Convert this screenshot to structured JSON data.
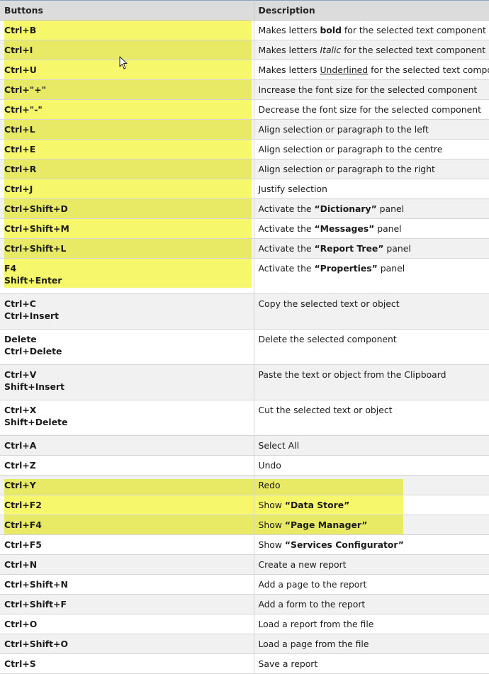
{
  "header": {
    "col_keys": "Buttons",
    "col_desc": "Description"
  },
  "colors": {
    "highlight": "#f6f76b",
    "header_bg": "#dcdcdc"
  },
  "rows": [
    {
      "keys": [
        "Ctrl+B"
      ],
      "desc": {
        "pre": "Makes letters ",
        "emph": "bold",
        "post": " for the selected text component"
      }
    },
    {
      "keys": [
        "Ctrl+I"
      ],
      "desc": {
        "pre": "Makes letters ",
        "emph": "Italic",
        "post": " for the selected text component"
      }
    },
    {
      "keys": [
        "Ctrl+U"
      ],
      "desc": {
        "pre": "Makes letters ",
        "emph": "Underlined",
        "post": " for the selected text compone"
      }
    },
    {
      "keys": [
        "Ctrl+\"+\""
      ],
      "desc": {
        "pre": "Increase the font size for the selected component",
        "emph": "",
        "post": ""
      }
    },
    {
      "keys": [
        "Ctrl+\"-\""
      ],
      "desc": {
        "pre": "Decrease the font size for the selected component",
        "emph": "",
        "post": ""
      }
    },
    {
      "keys": [
        "Ctrl+L"
      ],
      "desc": {
        "pre": "Align selection or paragraph to the left",
        "emph": "",
        "post": ""
      }
    },
    {
      "keys": [
        "Ctrl+E"
      ],
      "desc": {
        "pre": "Align selection or paragraph to the centre",
        "emph": "",
        "post": ""
      }
    },
    {
      "keys": [
        "Ctrl+R"
      ],
      "desc": {
        "pre": "Align selection or paragraph to the right",
        "emph": "",
        "post": ""
      }
    },
    {
      "keys": [
        "Ctrl+J"
      ],
      "desc": {
        "pre": "Justify selection",
        "emph": "",
        "post": ""
      }
    },
    {
      "keys": [
        "Ctrl+Shift+D"
      ],
      "desc": {
        "pre": "Activate the ",
        "emph": "“Dictionary”",
        "post": " panel"
      }
    },
    {
      "keys": [
        "Ctrl+Shift+M"
      ],
      "desc": {
        "pre": "Activate the ",
        "emph": "“Messages”",
        "post": " panel"
      }
    },
    {
      "keys": [
        "Ctrl+Shift+L"
      ],
      "desc": {
        "pre": "Activate the ",
        "emph": "“Report Tree”",
        "post": " panel"
      }
    },
    {
      "keys": [
        "F4",
        "Shift+Enter"
      ],
      "desc": {
        "pre": "Activate the ",
        "emph": "“Properties”",
        "post": " panel"
      }
    },
    {
      "keys": [
        "Ctrl+C",
        "Ctrl+Insert"
      ],
      "desc": {
        "pre": "Copy the selected text or object",
        "emph": "",
        "post": ""
      }
    },
    {
      "keys": [
        "Delete",
        "Ctrl+Delete"
      ],
      "desc": {
        "pre": "Delete the selected component",
        "emph": "",
        "post": ""
      }
    },
    {
      "keys": [
        "Ctrl+V",
        "Shift+Insert"
      ],
      "desc": {
        "pre": "Paste the text or object from the Clipboard",
        "emph": "",
        "post": ""
      }
    },
    {
      "keys": [
        "Ctrl+X",
        "Shift+Delete"
      ],
      "desc": {
        "pre": "Cut the selected text or object",
        "emph": "",
        "post": ""
      }
    },
    {
      "keys": [
        "Ctrl+A"
      ],
      "desc": {
        "pre": "Select All",
        "emph": "",
        "post": ""
      }
    },
    {
      "keys": [
        "Ctrl+Z"
      ],
      "desc": {
        "pre": "Undo",
        "emph": "",
        "post": ""
      }
    },
    {
      "keys": [
        "Ctrl+Y"
      ],
      "desc": {
        "pre": "Redo",
        "emph": "",
        "post": ""
      }
    },
    {
      "keys": [
        "Ctrl+F2"
      ],
      "desc": {
        "pre": "Show ",
        "emph": "“Data Store”",
        "post": ""
      }
    },
    {
      "keys": [
        "Ctrl+F4"
      ],
      "desc": {
        "pre": "Show ",
        "emph": "“Page Manager”",
        "post": ""
      }
    },
    {
      "keys": [
        "Ctrl+F5"
      ],
      "desc": {
        "pre": "Show ",
        "emph": "“Services Configurator”",
        "post": ""
      }
    },
    {
      "keys": [
        "Ctrl+N"
      ],
      "desc": {
        "pre": "Create a new report",
        "emph": "",
        "post": ""
      }
    },
    {
      "keys": [
        "Ctrl+Shift+N"
      ],
      "desc": {
        "pre": "Add a page to the report",
        "emph": "",
        "post": ""
      }
    },
    {
      "keys": [
        "Ctrl+Shift+F"
      ],
      "desc": {
        "pre": "Add a form to the report",
        "emph": "",
        "post": ""
      }
    },
    {
      "keys": [
        "Ctrl+O"
      ],
      "desc": {
        "pre": "Load a report from the file",
        "emph": "",
        "post": ""
      }
    },
    {
      "keys": [
        "Ctrl+Shift+O"
      ],
      "desc": {
        "pre": "Load a page from the file",
        "emph": "",
        "post": ""
      }
    },
    {
      "keys": [
        "Ctrl+S"
      ],
      "desc": {
        "pre": "Save a report",
        "emph": "",
        "post": ""
      }
    }
  ]
}
